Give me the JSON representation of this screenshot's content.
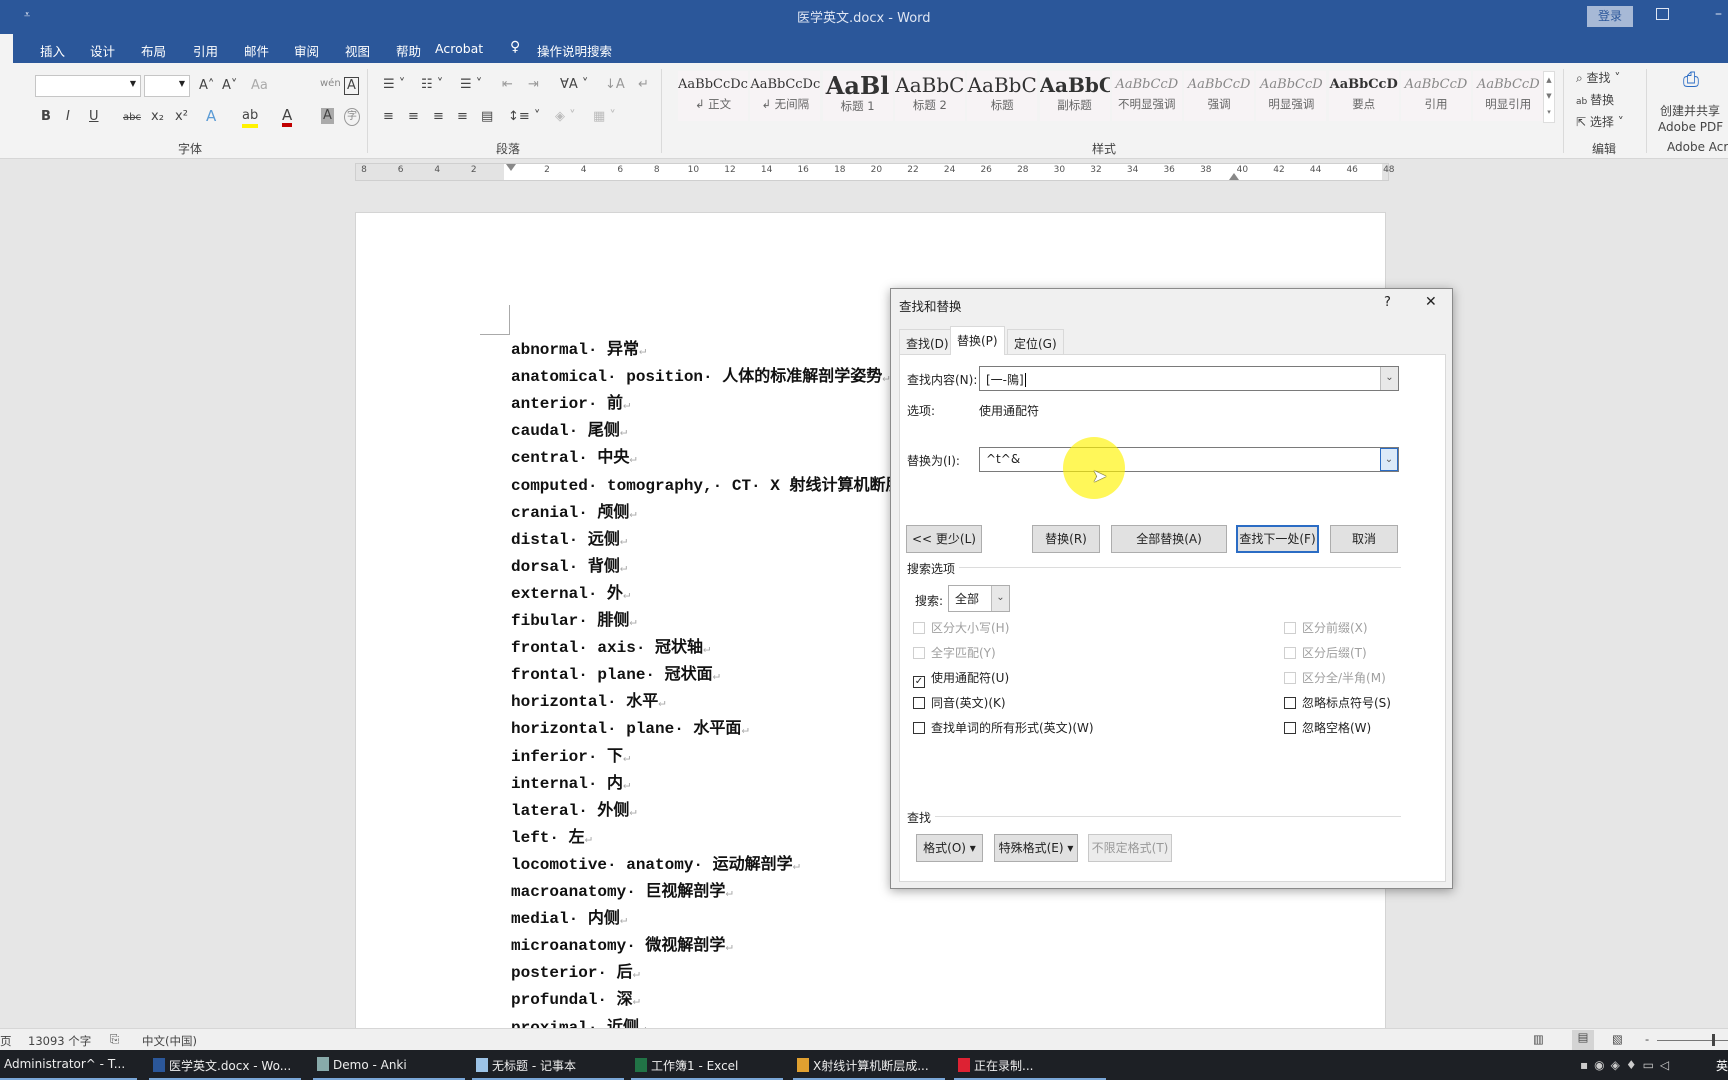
{
  "window": {
    "title": "医学英文.docx  -  Word",
    "login": "登录",
    "ribbon_display_icon": "ribbon-display-icon",
    "minimize": "–",
    "qat": "⩡"
  },
  "tabs": [
    "插入",
    "设计",
    "布局",
    "引用",
    "邮件",
    "审阅",
    "视图",
    "帮助",
    "Acrobat"
  ],
  "tell_me": "操作说明搜索",
  "ribbon": {
    "font_group": "字体",
    "paragraph_group": "段落",
    "styles_group": "样式",
    "editing_group": "编辑",
    "adobe_group": "Adobe Acrobat",
    "font_buttons": {
      "bold": "B",
      "italic": "I",
      "underline": "U",
      "strike": "abc",
      "sub": "x₂",
      "sup": "x²",
      "grow": "A˄",
      "shrink": "A˅",
      "case": "Aa",
      "char_border": "A",
      "char_shade": "A",
      "enclose": "字",
      "phonetic": "wén"
    },
    "styles": [
      {
        "sample": "AaBbCcDc",
        "name": "↲ 正文"
      },
      {
        "sample": "AaBbCcDc",
        "name": "↲ 无间隔"
      },
      {
        "sample": "AaBl",
        "name": "标题 1"
      },
      {
        "sample": "AaBbC",
        "name": "标题 2"
      },
      {
        "sample": "AaBbC",
        "name": "标题"
      },
      {
        "sample": "AaBbC",
        "name": "副标题"
      },
      {
        "sample": "AaBbCcD",
        "name": "不明显强调"
      },
      {
        "sample": "AaBbCcD",
        "name": "强调"
      },
      {
        "sample": "AaBbCcD",
        "name": "明显强调"
      },
      {
        "sample": "AaBbCcD",
        "name": "要点"
      },
      {
        "sample": "AaBbCcD",
        "name": "引用"
      },
      {
        "sample": "AaBbCcD",
        "name": "明显引用"
      }
    ],
    "editing": {
      "find": "查找",
      "replace": "替换",
      "select": "选择"
    },
    "adobe": {
      "create_line1": "创建并共享",
      "create_line2": "Adobe PDF",
      "group": "Adobe Acr"
    }
  },
  "ruler": [
    "8",
    "6",
    "4",
    "2",
    "",
    "2",
    "4",
    "6",
    "8",
    "10",
    "12",
    "14",
    "16",
    "18",
    "20",
    "22",
    "24",
    "26",
    "28",
    "30",
    "32",
    "34",
    "36",
    "38",
    "40",
    "42",
    "44",
    "46",
    "48"
  ],
  "document": {
    "lines": [
      "abnormal· 异常",
      "anatomical· position· 人体的标准解剖学姿势",
      "anterior· 前",
      "caudal· 尾侧",
      "central· 中央",
      "computed· tomography,· CT· X 射线计算机断层",
      "cranial· 颅侧",
      "distal· 远侧",
      "dorsal· 背侧",
      "external· 外",
      "fibular· 腓侧",
      "frontal· axis· 冠状轴",
      "frontal· plane· 冠状面",
      "horizontal· 水平",
      "horizontal· plane· 水平面",
      "inferior· 下",
      "internal· 内",
      "lateral· 外侧",
      "left· 左",
      "locomotive· anatomy· 运动解剖学",
      "macroanatomy· 巨视解剖学",
      "medial· 内侧",
      "microanatomy· 微视解剖学",
      "posterior· 后",
      "profundal· 深",
      "proximal· 近侧"
    ]
  },
  "dialog": {
    "title": "查找和替换",
    "help": "?",
    "close": "✕",
    "tabs": [
      "查找(D)",
      "替换(P)",
      "定位(G)"
    ],
    "find_label": "查找内容(N):",
    "find_value": "[一-隝]",
    "options_label": "选项:",
    "options_value": "使用通配符",
    "replace_label": "替换为(I):",
    "replace_value": "^t^&",
    "buttons": {
      "less": "<< 更少(L)",
      "replace": "替换(R)",
      "replace_all": "全部替换(A)",
      "find_next": "查找下一处(F)",
      "cancel": "取消"
    },
    "search_options_heading": "搜索选项",
    "search_label": "搜索:",
    "search_value": "全部",
    "checkboxes_left": [
      {
        "label": "区分大小写(H)",
        "checked": false,
        "disabled": true
      },
      {
        "label": "全字匹配(Y)",
        "checked": false,
        "disabled": true
      },
      {
        "label": "使用通配符(U)",
        "checked": true,
        "disabled": false
      },
      {
        "label": "同音(英文)(K)",
        "checked": false,
        "disabled": false
      },
      {
        "label": "查找单词的所有形式(英文)(W)",
        "checked": false,
        "disabled": false
      }
    ],
    "checkboxes_right": [
      {
        "label": "区分前缀(X)",
        "checked": false,
        "disabled": true
      },
      {
        "label": "区分后缀(T)",
        "checked": false,
        "disabled": true
      },
      {
        "label": "区分全/半角(M)",
        "checked": false,
        "disabled": true
      },
      {
        "label": "忽略标点符号(S)",
        "checked": false,
        "disabled": false
      },
      {
        "label": "忽略空格(W)",
        "checked": false,
        "disabled": false
      }
    ],
    "find_heading": "查找",
    "format_buttons": {
      "format": "格式(O) ▾",
      "special": "特殊格式(E) ▾",
      "no_format": "不限定格式(T)"
    }
  },
  "statusbar": {
    "page": "页",
    "words": "13093 个字",
    "language": "中文(中国)",
    "zoom_minus": "-"
  },
  "taskbar": [
    {
      "label": "Administrator^ - T...",
      "icon": "terminal-icon",
      "color": "#444"
    },
    {
      "label": "医学英文.docx - Wo...",
      "icon": "word-icon",
      "color": "#2b579a"
    },
    {
      "label": "Demo - Anki",
      "icon": "anki-icon",
      "color": "#8aa"
    },
    {
      "label": "无标题 - 记事本",
      "icon": "notepad-icon",
      "color": "#9cc3e6"
    },
    {
      "label": "工作簿1 - Excel",
      "icon": "excel-icon",
      "color": "#217346"
    },
    {
      "label": "X射线计算机断层成...",
      "icon": "chrome-icon",
      "color": "#e0a030"
    },
    {
      "label": "正在录制...",
      "icon": "recorder-icon",
      "color": "#d23"
    }
  ],
  "tray": "英",
  "colors": {
    "word_blue": "#2b579a",
    "highlight": "#fff200",
    "focus_blue": "#2b6cc4"
  }
}
